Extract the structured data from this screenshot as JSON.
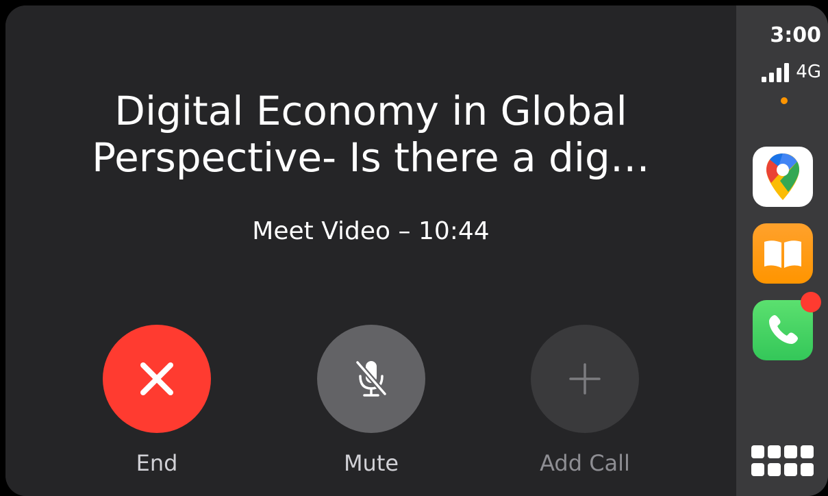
{
  "call": {
    "title_line1": "Digital Economy in Global",
    "title_line2": "Perspective- Is there a dig…",
    "subtitle": "Meet Video – 10:44"
  },
  "controls": {
    "end": {
      "label": "End",
      "icon": "close-icon",
      "color": "#ff3b30"
    },
    "mute": {
      "label": "Mute",
      "icon": "mic-off-icon",
      "color": "#636366"
    },
    "add_call": {
      "label": "Add Call",
      "icon": "plus-icon",
      "color": "#3a3a3c"
    }
  },
  "status": {
    "time": "3:00",
    "network": "4G",
    "signal_bars": 4,
    "mic_indicator_color": "#ff9500"
  },
  "dock": {
    "apps": [
      {
        "name": "Google Maps",
        "icon": "maps-pin-icon"
      },
      {
        "name": "Books",
        "icon": "book-icon",
        "color": "#ff9500"
      },
      {
        "name": "Phone",
        "icon": "phone-icon",
        "color": "#34c759",
        "badge": true,
        "badge_color": "#ff3b30"
      }
    ],
    "dashboard_icon": "grid-icon"
  }
}
